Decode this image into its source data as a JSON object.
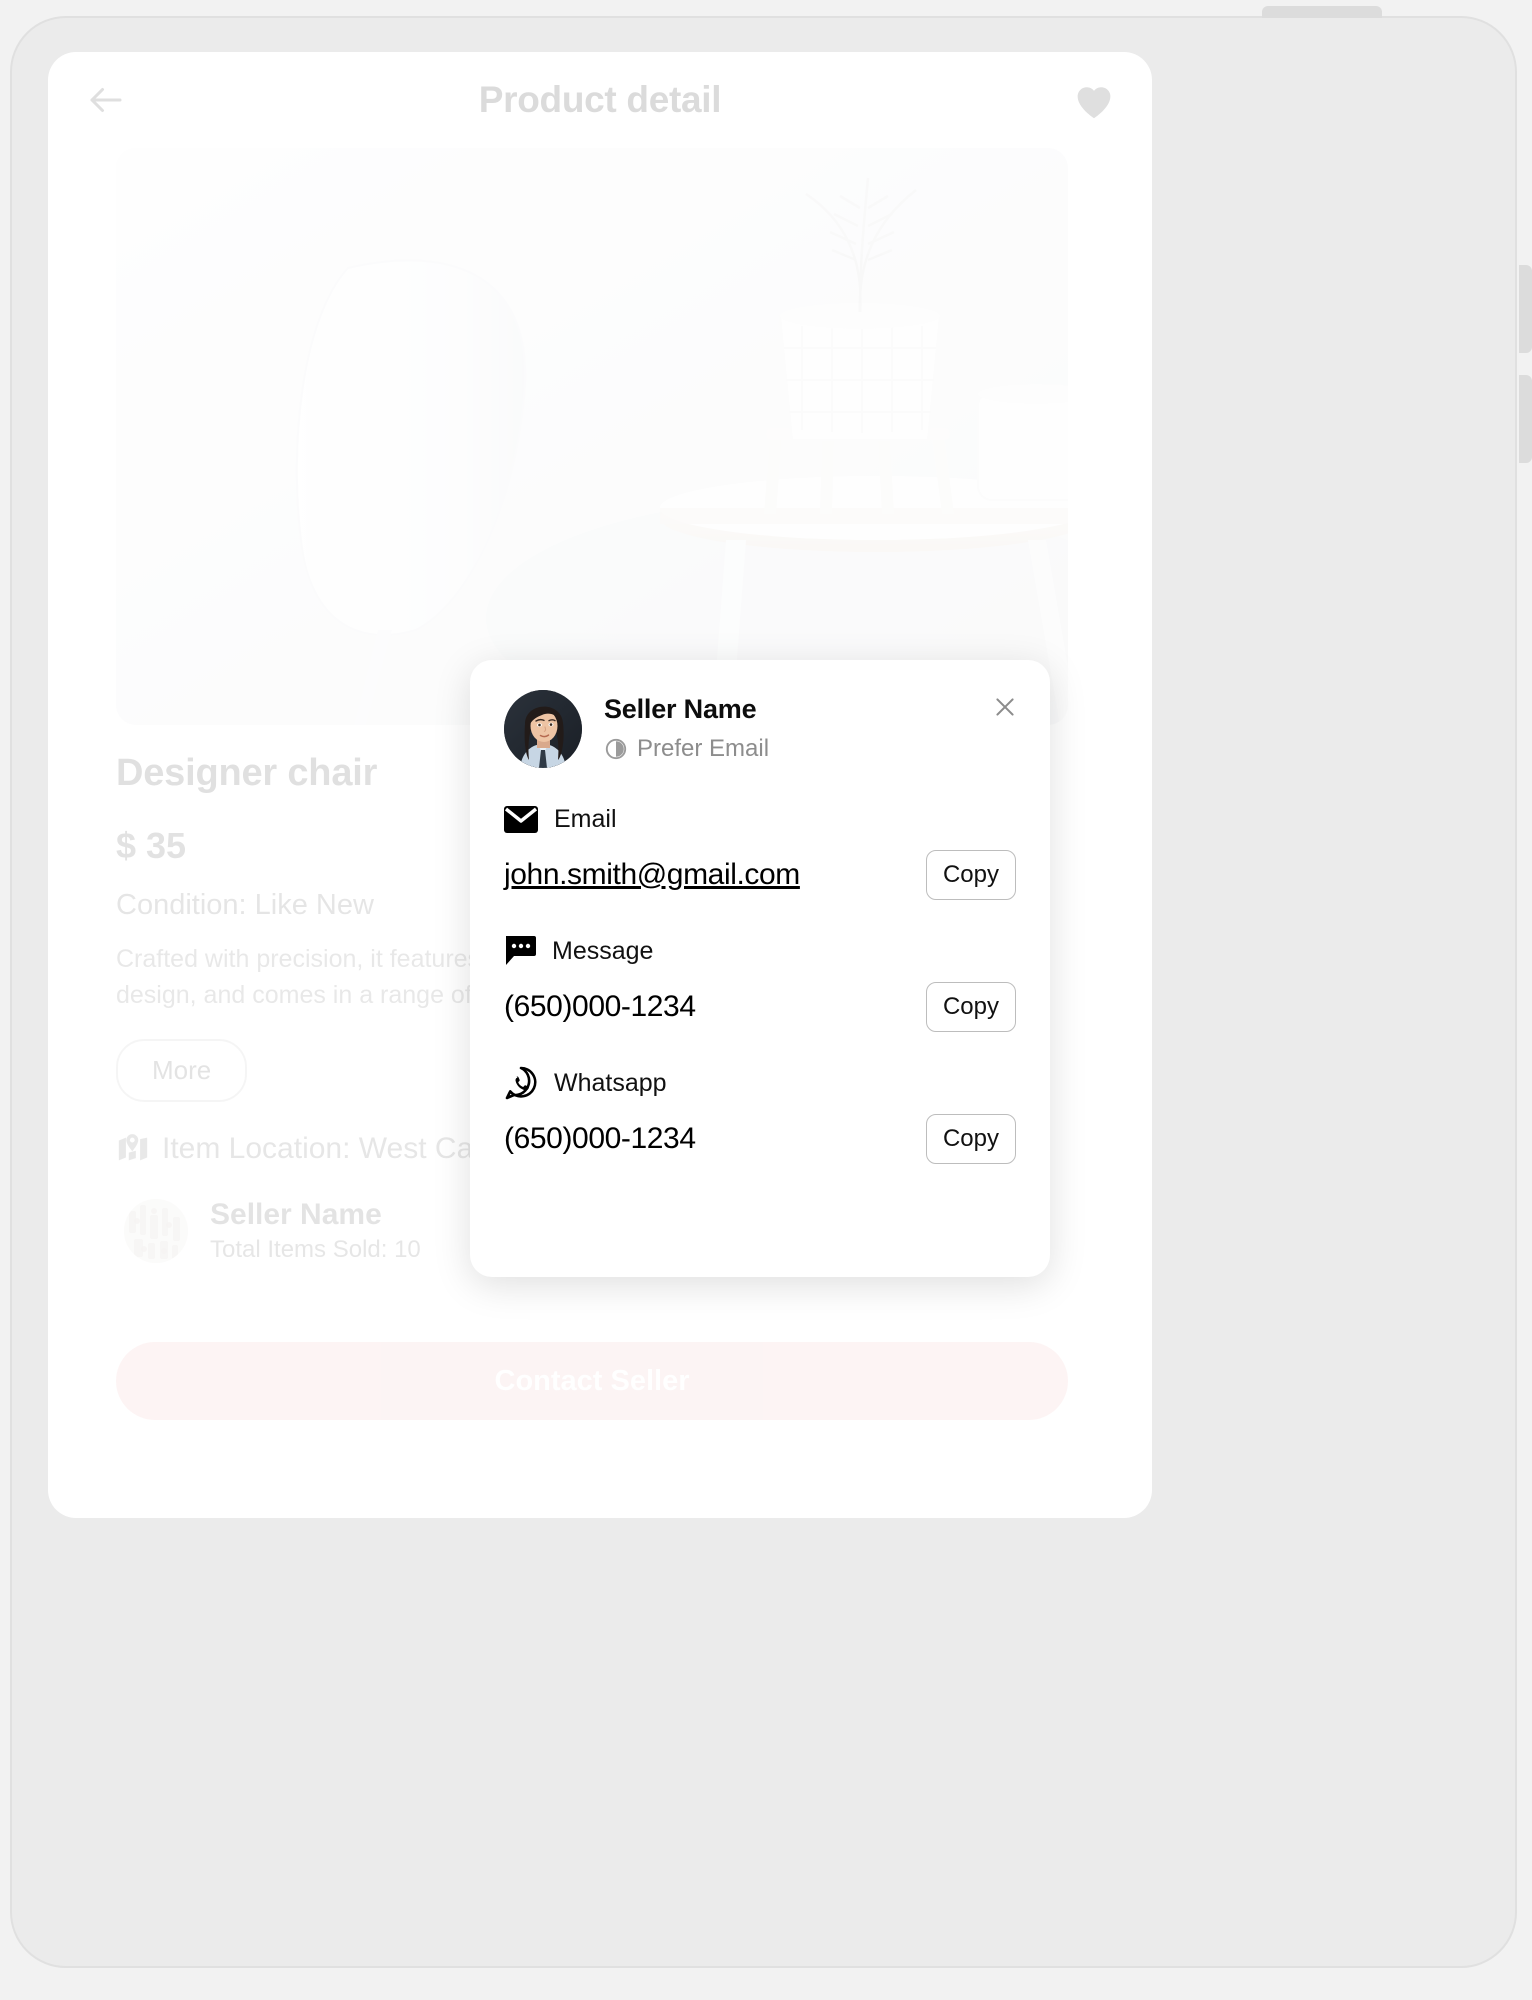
{
  "theme": {
    "accent_pink": "#f3c6c6",
    "frame_gray": "#ebebeb",
    "screen_white": "#ffffff"
  },
  "header": {
    "back_icon": "arrow-left-icon",
    "title": "Product detail",
    "favorite_icon": "heart-icon"
  },
  "product": {
    "image_alt": "white designer chair with side table, plant and mug",
    "name": "Designer chair",
    "price": "$ 35",
    "condition": "Condition: Like New",
    "description": "Crafted with precision, it features a sturdy frame, soft cushioning, unique curved design, and comes in a range of colors to complement any decor.",
    "more_label": "More",
    "location_icon": "map-pin-icon",
    "location": "Item Location: West Campus"
  },
  "seller_summary": {
    "avatar_icon": "seller-avatar",
    "name": "Seller Name",
    "items_sold": "Total Items Sold: 10"
  },
  "primary_action": {
    "label": "Contact Seller"
  },
  "contact_modal": {
    "avatar_icon": "seller-photo-avatar",
    "seller_name": "Seller Name",
    "preference_icon": "half-circle-icon",
    "preference_label": "Prefer Email",
    "close_icon": "close-icon",
    "methods": [
      {
        "icon": "envelope-icon",
        "type": "Email",
        "value": "john.smith@gmail.com",
        "underlined": true,
        "copy_label": "Copy"
      },
      {
        "icon": "message-bubble-icon",
        "type": "Message",
        "value": "(650)000-1234",
        "underlined": false,
        "copy_label": "Copy"
      },
      {
        "icon": "whatsapp-icon",
        "type": "Whatsapp",
        "value": "(650)000-1234",
        "underlined": false,
        "copy_label": "Copy"
      }
    ]
  }
}
